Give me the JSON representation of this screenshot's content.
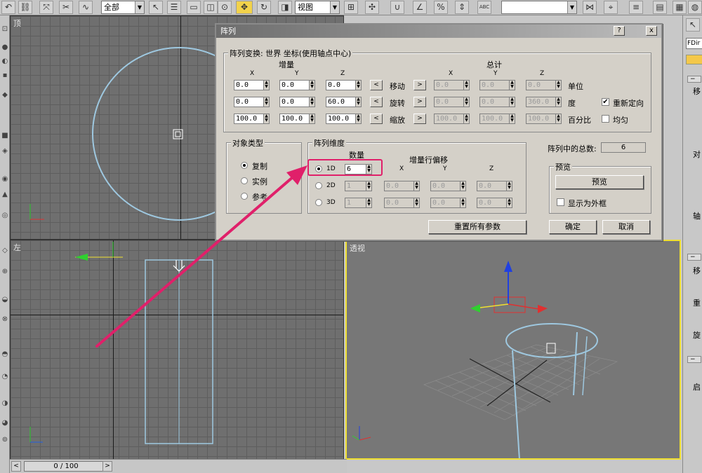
{
  "toolbar": {
    "selection_filter": "全部",
    "ref_coord": "视图",
    "abc_icon": "ABC"
  },
  "viewports": {
    "top_label": "顶",
    "left_label": "左",
    "perspective_label": "透视"
  },
  "timeline": {
    "frame_display": "0 / 100",
    "prev": "<",
    "next": ">"
  },
  "right_panel": {
    "object_name": "FDir",
    "chars": [
      "移",
      "对",
      "轴",
      "移",
      "重",
      "旋",
      "启"
    ]
  },
  "dialog": {
    "title": "阵列",
    "help_btn": "?",
    "close_btn": "x",
    "transform_group": {
      "label": "阵列变换: 世界 坐标(使用轴点中心)",
      "incremental_label": "增量",
      "totals_label": "总计",
      "axis_headers": [
        "X",
        "Y",
        "Z"
      ],
      "rows": [
        {
          "name": "移动",
          "inc": [
            "0.0",
            "0.0",
            "0.0"
          ],
          "total": [
            "0.0",
            "0.0",
            "0.0"
          ],
          "unit": "单位",
          "left_btn": "<",
          "right_btn": ">"
        },
        {
          "name": "旋转",
          "inc": [
            "0.0",
            "0.0",
            "60.0"
          ],
          "total": [
            "0.0",
            "0.0",
            "360.0"
          ],
          "unit": "度",
          "left_btn": "<",
          "right_btn": ">"
        },
        {
          "name": "缩放",
          "inc": [
            "100.0",
            "100.0",
            "100.0"
          ],
          "total": [
            "100.0",
            "100.0",
            "100.0"
          ],
          "unit": "百分比",
          "left_btn": "<",
          "right_btn": ">"
        }
      ],
      "reorient_label": "重新定向",
      "reorient_checked": true,
      "uniform_label": "均匀",
      "uniform_checked": false
    },
    "object_type": {
      "label": "对象类型",
      "options": [
        "复制",
        "实例",
        "参考"
      ],
      "selected": "复制"
    },
    "dimensions": {
      "label": "阵列维度",
      "count_label": "数量",
      "row_offsets_label": "增量行偏移",
      "axis_headers": [
        "X",
        "Y",
        "Z"
      ],
      "rows": [
        {
          "dim": "1D",
          "count": "6",
          "offsets": []
        },
        {
          "dim": "2D",
          "count": "1",
          "offsets": [
            "0.0",
            "0.0",
            "0.0"
          ]
        },
        {
          "dim": "3D",
          "count": "1",
          "offsets": [
            "0.0",
            "0.0",
            "0.0"
          ]
        }
      ],
      "selected": "1D"
    },
    "total_in_array_label": "阵列中的总数:",
    "total_in_array_value": "6",
    "preview_group": {
      "label": "预览",
      "preview_button": "预览",
      "show_as_box_label": "显示为外框",
      "show_as_box_checked": false
    },
    "reset_button": "重置所有参数",
    "ok_button": "确定",
    "cancel_button": "取消"
  },
  "colors": {
    "highlight": "#e0206a",
    "active_viewport_border": "#f0e030",
    "object_wire": "#9ec8e0"
  }
}
